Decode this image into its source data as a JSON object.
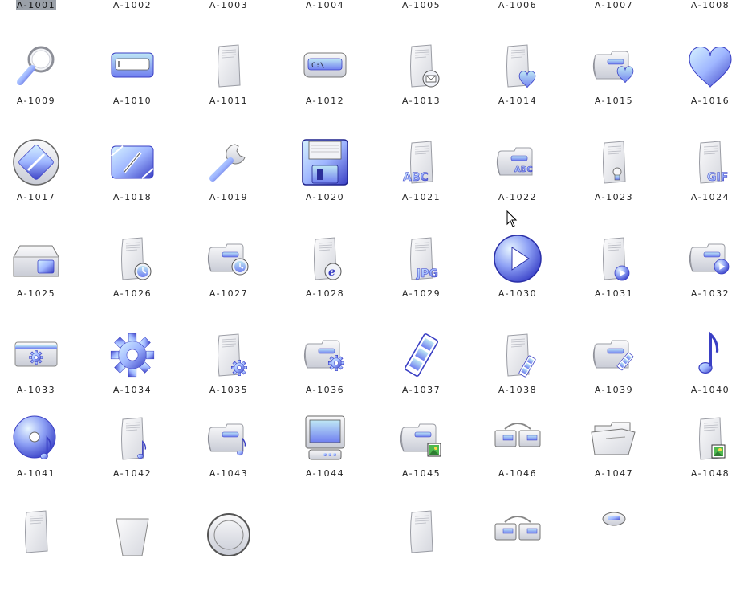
{
  "items": [
    {
      "label": "A-1001",
      "icon": "blank",
      "selected": true
    },
    {
      "label": "A-1002",
      "icon": "blank"
    },
    {
      "label": "A-1003",
      "icon": "blank"
    },
    {
      "label": "A-1004",
      "icon": "blank"
    },
    {
      "label": "A-1005",
      "icon": "blank"
    },
    {
      "label": "A-1006",
      "icon": "blank"
    },
    {
      "label": "A-1007",
      "icon": "blank"
    },
    {
      "label": "A-1008",
      "icon": "blank"
    },
    {
      "label": "A-1009",
      "icon": "magnifier-icon"
    },
    {
      "label": "A-1010",
      "icon": "input-field-icon"
    },
    {
      "label": "A-1011",
      "icon": "document-icon"
    },
    {
      "label": "A-1012",
      "icon": "command-prompt-icon",
      "text": "C:\\"
    },
    {
      "label": "A-1013",
      "icon": "document-mail-icon"
    },
    {
      "label": "A-1014",
      "icon": "document-heart-icon"
    },
    {
      "label": "A-1015",
      "icon": "folder-heart-icon"
    },
    {
      "label": "A-1016",
      "icon": "heart-icon"
    },
    {
      "label": "A-1017",
      "icon": "edit-circle-icon"
    },
    {
      "label": "A-1018",
      "icon": "edit-icon"
    },
    {
      "label": "A-1019",
      "icon": "wrench-icon"
    },
    {
      "label": "A-1020",
      "icon": "floppy-disk-icon"
    },
    {
      "label": "A-1021",
      "icon": "document-abc-icon",
      "text": "ABC"
    },
    {
      "label": "A-1022",
      "icon": "folder-abc-icon",
      "text": "ABC"
    },
    {
      "label": "A-1023",
      "icon": "document-bulb-icon"
    },
    {
      "label": "A-1024",
      "icon": "document-gif-icon",
      "text": "GIF"
    },
    {
      "label": "A-1025",
      "icon": "drive-icon"
    },
    {
      "label": "A-1026",
      "icon": "document-clock-icon"
    },
    {
      "label": "A-1027",
      "icon": "folder-clock-icon"
    },
    {
      "label": "A-1028",
      "icon": "document-ie-icon"
    },
    {
      "label": "A-1029",
      "icon": "document-jpg-icon",
      "text": "JPG"
    },
    {
      "label": "A-1030",
      "icon": "play-button-icon"
    },
    {
      "label": "A-1031",
      "icon": "document-play-icon"
    },
    {
      "label": "A-1032",
      "icon": "folder-play-icon"
    },
    {
      "label": "A-1033",
      "icon": "settings-panel-icon"
    },
    {
      "label": "A-1034",
      "icon": "gear-icon"
    },
    {
      "label": "A-1035",
      "icon": "document-gear-icon"
    },
    {
      "label": "A-1036",
      "icon": "folder-gear-icon"
    },
    {
      "label": "A-1037",
      "icon": "film-strip-icon"
    },
    {
      "label": "A-1038",
      "icon": "document-film-icon"
    },
    {
      "label": "A-1039",
      "icon": "folder-film-icon"
    },
    {
      "label": "A-1040",
      "icon": "music-note-icon"
    },
    {
      "label": "A-1041",
      "icon": "cd-music-icon"
    },
    {
      "label": "A-1042",
      "icon": "document-music-icon"
    },
    {
      "label": "A-1043",
      "icon": "folder-music-icon"
    },
    {
      "label": "A-1044",
      "icon": "computer-monitor-icon"
    },
    {
      "label": "A-1045",
      "icon": "folder-image-icon"
    },
    {
      "label": "A-1046",
      "icon": "network-folders-icon"
    },
    {
      "label": "A-1047",
      "icon": "open-folder-icon"
    },
    {
      "label": "A-1048",
      "icon": "document-image-icon"
    },
    {
      "label": "",
      "icon": "document-icon"
    },
    {
      "label": "",
      "icon": "cup-icon"
    },
    {
      "label": "",
      "icon": "globe-icon"
    },
    {
      "label": "",
      "icon": "blank"
    },
    {
      "label": "",
      "icon": "document-icon"
    },
    {
      "label": "",
      "icon": "network-folders-icon"
    },
    {
      "label": "",
      "icon": "user-icon"
    },
    {
      "label": "",
      "icon": "blank"
    }
  ],
  "colors": {
    "accent": "#6f7ef0",
    "accent_light": "#bfe8f5",
    "accent_dark": "#3a3fc4",
    "paper": "#eeeeef",
    "paper_edge": "#9a9ca4",
    "selection": "#9aa0a8"
  },
  "cursor_icon": "mouse-pointer-icon"
}
